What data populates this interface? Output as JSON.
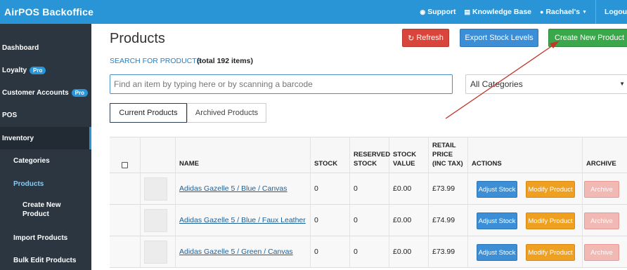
{
  "app": {
    "title": "AirPOS Backoffice"
  },
  "topnav": {
    "support": "Support",
    "knowledge_base": "Knowledge Base",
    "user": "Rachael's",
    "logout": "Logout"
  },
  "sidebar": {
    "items": [
      {
        "label": "Dashboard"
      },
      {
        "label": "Loyalty",
        "badge": "Pro"
      },
      {
        "label": "Customer Accounts",
        "badge": "Pro"
      },
      {
        "label": "POS"
      },
      {
        "label": "Inventory"
      },
      {
        "label": "Categories"
      },
      {
        "label": "Products"
      },
      {
        "label_line1": "Create New",
        "label_line2": "Product"
      },
      {
        "label": "Import Products"
      },
      {
        "label": "Bulk Edit Products"
      }
    ]
  },
  "page": {
    "title": "Products",
    "refresh_label": "Refresh",
    "export_label": "Export Stock Levels",
    "create_label": "Create New Product",
    "search_link": "SEARCH FOR PRODUCTS",
    "search_count": "(total 192 items)",
    "search_placeholder": "Find an item by typing here or by scanning a barcode",
    "category_selected": "All Categories",
    "tabs": [
      {
        "label": "Current Products"
      },
      {
        "label": "Archived Products"
      }
    ]
  },
  "table": {
    "headers": {
      "name": "NAME",
      "stock": "STOCK",
      "reserved_1": "RESERVED",
      "reserved_2": "STOCK",
      "value_1": "STOCK",
      "value_2": "VALUE",
      "price_1": "RETAIL",
      "price_2": "PRICE",
      "price_3": "(INC TAX)",
      "actions": "ACTIONS",
      "archive": "ARCHIVE"
    },
    "rows": [
      {
        "name": "Adidas Gazelle 5 / Blue / Canvas",
        "stock": "0",
        "reserved": "0",
        "value": "£0.00",
        "price": "£73.99"
      },
      {
        "name": "Adidas Gazelle 5 / Blue / Faux Leather",
        "stock": "0",
        "reserved": "0",
        "value": "£0.00",
        "price": "£74.99"
      },
      {
        "name": "Adidas Gazelle 5 / Green / Canvas",
        "stock": "0",
        "reserved": "0",
        "value": "£0.00",
        "price": "£73.99"
      }
    ],
    "row_buttons": {
      "adjust": "Adjust Stock",
      "modify": "Modify Product",
      "archive": "Archive"
    }
  },
  "icons": {
    "support": "chat-icon",
    "knowledge_base": "book-icon",
    "user": "user-icon",
    "refresh": "refresh-icon"
  },
  "colors": {
    "topbar": "#2a95d6",
    "sidebar": "#2c3641",
    "refresh": "#d9453a",
    "export": "#3c8fd6",
    "create": "#3aa84a",
    "modify": "#f0a020",
    "archive": "#f2b8b3",
    "annotation_arrow": "#c0392b"
  }
}
